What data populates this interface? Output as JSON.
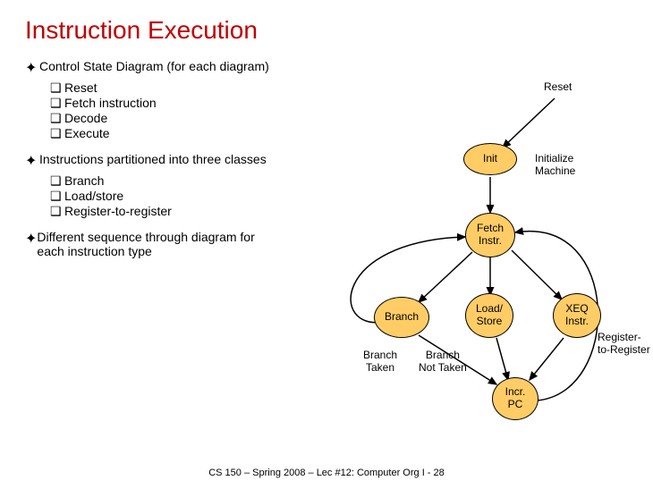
{
  "title": "Instruction Execution",
  "bullets": {
    "b1": {
      "text": "Control State Diagram (for each diagram)",
      "sub": [
        "Reset",
        "Fetch instruction",
        "Decode",
        "Execute"
      ]
    },
    "b2": {
      "text": "Instructions partitioned into three classes",
      "sub": [
        "Branch",
        "Load/store",
        "Register-to-register"
      ]
    },
    "b3": {
      "text": "Different sequence through diagram for each instruction type",
      "sub": []
    }
  },
  "nodes": {
    "init": "Init",
    "fetch": "Fetch\nInstr.",
    "branch": "Branch",
    "load": "Load/\nStore",
    "xeq": "XEQ\nInstr.",
    "incr": "Incr.\nPC"
  },
  "labels": {
    "reset": "Reset",
    "initmach": "Initialize\nMachine",
    "r2r": "Register-\nto-Register",
    "btaken": "Branch\nTaken",
    "bnottaken": "Branch\nNot Taken"
  },
  "footer": "CS 150 – Spring 2008 – Lec #12: Computer Org I - 28"
}
